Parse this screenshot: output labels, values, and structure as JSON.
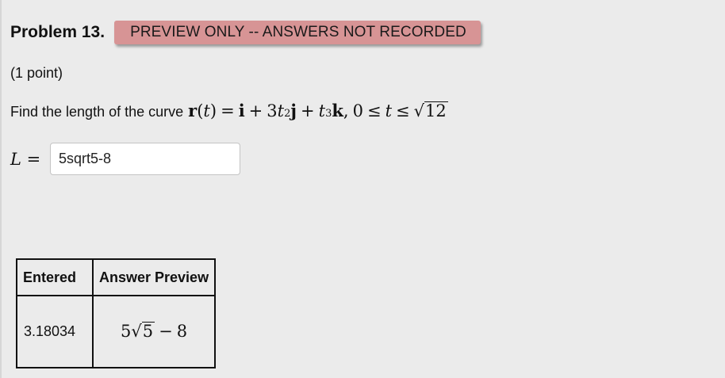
{
  "problem": {
    "title": "Problem 13.",
    "badge": "PREVIEW ONLY -- ANSWERS NOT RECORDED",
    "badge_color": "#d79495",
    "points": "(1 point)"
  },
  "question": {
    "text": "Find the length of the curve",
    "math": {
      "r": "r",
      "open_paren": "(",
      "t": "t",
      "close_paren": ")",
      "equals": "=",
      "i": "i",
      "plus1": "+",
      "coef": "3",
      "t2": "t",
      "exp2": "2",
      "j": "j",
      "plus2": "+",
      "t3": "t",
      "exp3": "3",
      "k": "k",
      "comma": ",",
      "zero": "0",
      "le1": "≤",
      "tvar": "t",
      "le2": "≤",
      "sqrt_symbol": "√",
      "radicand": "12"
    }
  },
  "answer": {
    "label_var": "L",
    "label_eq": "=",
    "value": "5sqrt5-8"
  },
  "results_table": {
    "headers": [
      "Entered",
      "Answer Preview"
    ],
    "entered": "3.18034",
    "preview": {
      "coef": "5",
      "sqrt_symbol": "√",
      "radicand": "5",
      "minus": "−",
      "constant": "8"
    }
  }
}
